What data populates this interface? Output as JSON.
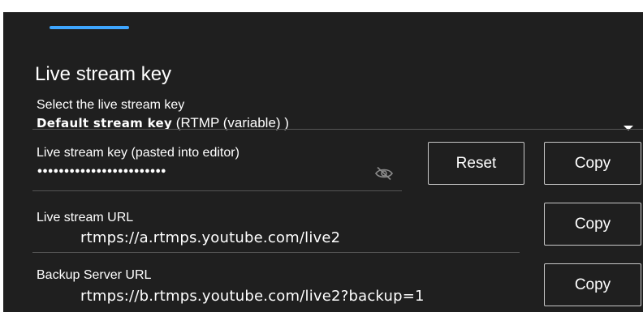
{
  "stream_key_section": {
    "title": "Live stream key",
    "select_label": "Select the live stream key",
    "selected_key_name": "Default stream key",
    "selected_key_type": " (RTMP (variable) )"
  },
  "stream_key_field": {
    "label": "Live stream key (pasted into editor)",
    "masked_value": "••••••••••••••••••••••••",
    "reset_label": "Reset",
    "copy_label": "Copy"
  },
  "stream_url": {
    "label": "Live stream URL",
    "value": "rtmps://a.rtmps.youtube.com/live2",
    "copy_label": "Copy"
  },
  "backup_url": {
    "label": "Backup Server URL",
    "value": "rtmps://b.rtmps.youtube.com/live2?backup=1",
    "copy_label": "Copy"
  },
  "icons": {
    "visibility": "eye-off-icon",
    "dropdown": "dropdown-arrow-icon"
  },
  "colors": {
    "panel_background": "#1f1f1f",
    "tab_indicator": "#3ea6ff",
    "text": "#ffffff",
    "divider": "#555555"
  }
}
